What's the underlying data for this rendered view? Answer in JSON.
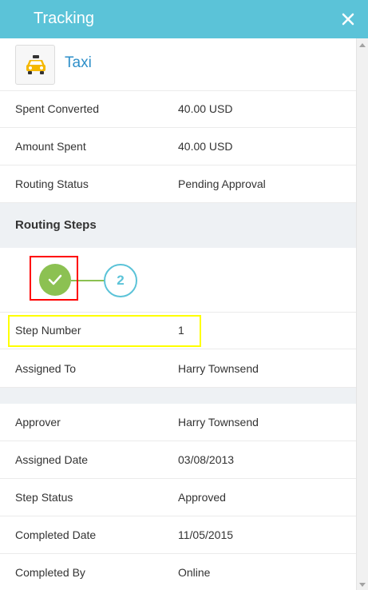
{
  "header": {
    "title": "Tracking"
  },
  "app": {
    "icon": "taxi-icon",
    "title": "Taxi"
  },
  "summary": [
    {
      "label": "Spent Converted",
      "value": "40.00 USD"
    },
    {
      "label": "Amount Spent",
      "value": "40.00 USD"
    },
    {
      "label": "Routing Status",
      "value": "Pending Approval"
    }
  ],
  "routing": {
    "title": "Routing Steps",
    "steps": [
      {
        "state": "completed",
        "icon": "checkmark-icon"
      },
      {
        "state": "pending",
        "label": "2"
      }
    ]
  },
  "step_details": [
    {
      "label": "Step Number",
      "value": "1"
    },
    {
      "label": "Assigned To",
      "value": "Harry Townsend"
    }
  ],
  "approval_details": [
    {
      "label": "Approver",
      "value": "Harry Townsend"
    },
    {
      "label": "Assigned Date",
      "value": "03/08/2013"
    },
    {
      "label": "Step Status",
      "value": "Approved"
    },
    {
      "label": "Completed Date",
      "value": "11/05/2015"
    },
    {
      "label": "Completed By",
      "value": "Online"
    }
  ],
  "colors": {
    "header_bg": "#5bc3d8",
    "accent_link": "#2e8fc9",
    "step_done": "#8cc152",
    "highlight_red": "#ff0000",
    "highlight_yellow": "#ffff00"
  }
}
